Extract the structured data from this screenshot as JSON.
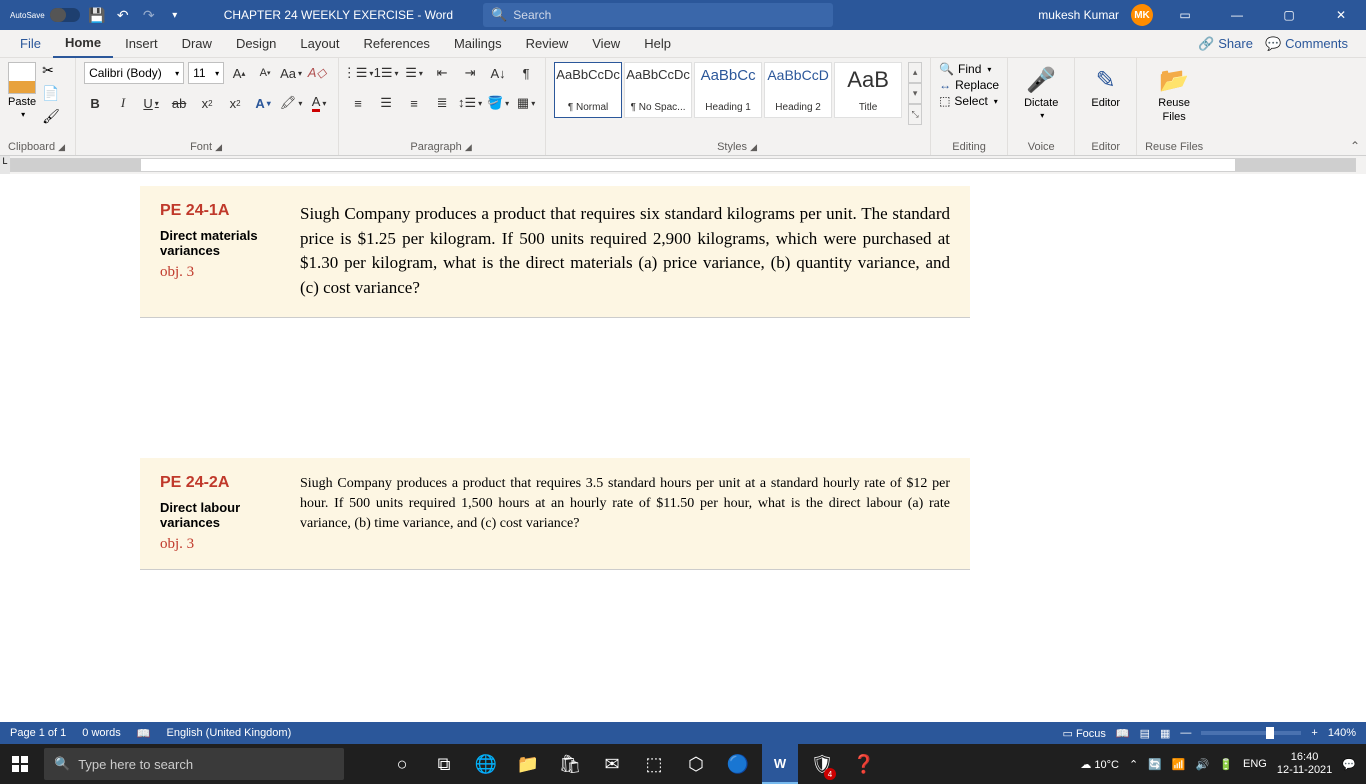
{
  "title_bar": {
    "autosave_label": "AutoSave",
    "autosave_state": "Off",
    "doc_title": "CHAPTER 24 WEEKLY EXERCISE  - Word",
    "search_placeholder": "Search",
    "user_name": "mukesh Kumar",
    "user_initials": "MK"
  },
  "tabs": {
    "file": "File",
    "home": "Home",
    "insert": "Insert",
    "draw": "Draw",
    "design": "Design",
    "layout": "Layout",
    "references": "References",
    "mailings": "Mailings",
    "review": "Review",
    "view": "View",
    "help": "Help",
    "share": "Share",
    "comments": "Comments"
  },
  "ribbon": {
    "clipboard": {
      "paste": "Paste",
      "label": "Clipboard"
    },
    "font": {
      "name": "Calibri (Body)",
      "size": "11",
      "label": "Font"
    },
    "paragraph": {
      "label": "Paragraph"
    },
    "styles": {
      "label": "Styles",
      "preview": "AaBbCcDc",
      "preview_h1": "AaBbCc",
      "preview_h2": "AaBbCcD",
      "preview_title": "AaB",
      "items": [
        {
          "name": "¶ Normal"
        },
        {
          "name": "¶ No Spac..."
        },
        {
          "name": "Heading 1"
        },
        {
          "name": "Heading 2"
        },
        {
          "name": "Title"
        }
      ]
    },
    "editing": {
      "find": "Find",
      "replace": "Replace",
      "select": "Select",
      "label": "Editing"
    },
    "voice": {
      "dictate": "Dictate",
      "label": "Voice"
    },
    "editor": {
      "editor": "Editor",
      "label": "Editor"
    },
    "reuse": {
      "reuse": "Reuse Files",
      "reuse_short": "Reuse",
      "files": "Files",
      "label": "Reuse Files"
    }
  },
  "document": {
    "ex1": {
      "code": "PE 24-1A",
      "desc": "Direct materials variances",
      "obj": "obj. 3",
      "body": "Siugh Company produces a product that requires six standard kilograms per unit. The standard price is $1.25 per kilogram. If 500 units required 2,900 kilograms, which were purchased at $1.30 per kilogram, what is the direct materials (a) price variance, (b) quantity variance, and (c) cost variance?"
    },
    "ex2": {
      "code": "PE 24-2A",
      "desc": "Direct labour variances",
      "obj": "obj. 3",
      "body": "Siugh Company produces a product that requires 3.5 standard hours per unit at a standard hourly rate of $12 per hour. If 500 units required 1,500 hours at an hourly rate of $11.50 per hour, what is the direct labour (a) rate variance, (b) time variance, and (c) cost variance?"
    }
  },
  "status": {
    "page": "Page 1 of 1",
    "words": "0 words",
    "language": "English (United Kingdom)",
    "focus": "Focus",
    "zoom": "140%"
  },
  "taskbar": {
    "search": "Type here to search",
    "weather": "10°C",
    "lang": "ENG",
    "time": "16:40",
    "date": "12-11-2021",
    "badge": "4"
  }
}
